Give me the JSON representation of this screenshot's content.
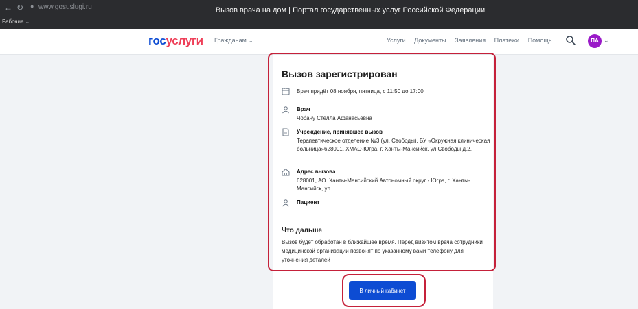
{
  "browser": {
    "url": "www.gosuslugi.ru",
    "tab_title": "Вызов врача на дом | Портал государственных услуг Российской Федерации",
    "bookmarks_label": "Рабочие"
  },
  "header": {
    "logo_part1": "гос",
    "logo_part2": "услуги",
    "citizens_label": "Гражданам",
    "nav": [
      "Услуги",
      "Документы",
      "Заявления",
      "Платежи",
      "Помощь"
    ],
    "avatar_initials": "ПА"
  },
  "card": {
    "title": "Вызов зарегистрирован",
    "date_text": "Врач придёт 08 ноября, пятница, с 11:50 до 17:00",
    "doctor": {
      "label": "Врач",
      "value": "Чобану Стелла Афанасьевна"
    },
    "institution": {
      "label": "Учреждение, принявшее вызов",
      "value": "Терапевтическое отделение №3 (ул. Свободы), БУ «Окружная клиническая больница»628001, ХМАО-Югра, г. Ханты-Мансийск, ул.Свободы д.2."
    },
    "address": {
      "label": "Адрес вызова",
      "value": "628001, АО. Ханты-Мансийский Автономный округ - Югра, г. Ханты-Мансийск, ул."
    },
    "patient": {
      "label": "Пациент"
    },
    "next_title": "Что дальше",
    "next_text": "Вызов будет обработан в ближайшее время. Перед визитом врача сотрудники медицинской организации позвонят по указанному вами телефону для уточнения деталей",
    "button_label": "В личный кабинет"
  },
  "colors": {
    "brand_blue": "#0d4cd3",
    "brand_red": "#ee3f58",
    "highlight": "#c5213a",
    "avatar": "#9a1ac8"
  }
}
